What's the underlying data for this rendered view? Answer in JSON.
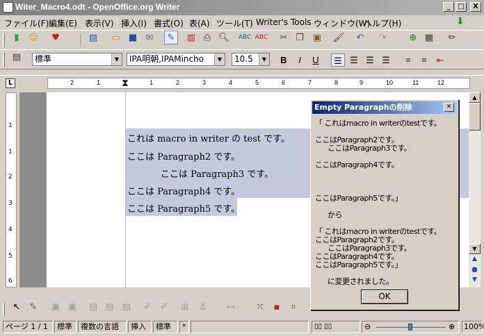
{
  "window": {
    "title": "Witer_Macro4.odt - OpenOffice.org Writer"
  },
  "window_buttons": {
    "minimize": "_",
    "maximize": "□",
    "close": "X"
  },
  "menu": [
    "ファイル(F)",
    "編集(E)",
    "表示(V)",
    "挿入(I)",
    "書式(O)",
    "表(A)",
    "ツール(T)",
    "Writer's Tools",
    "ウィンドウ(W)",
    "ヘルプ(H)"
  ],
  "format_toolbar": {
    "style": "標準",
    "font": "IPA明朝,IPAMincho",
    "size": "10.5",
    "bold": "B",
    "italic": "I",
    "underline": "U"
  },
  "ruler": {
    "marks": [
      "2",
      "1",
      "1",
      "2",
      "3",
      "4",
      "5",
      "6",
      "7",
      "8",
      "9",
      "10",
      "11",
      "12"
    ]
  },
  "vruler": {
    "marks": [
      "1",
      "1",
      "2",
      "3",
      "4",
      "5",
      "6"
    ]
  },
  "document": {
    "lines": [
      "これは macro in writer の test です。",
      "ここは Paragraph2 です。",
      "ここは Paragraph3 です。",
      "ここは Paragraph4 です。",
      "ここは Paragraph5 です。"
    ]
  },
  "dialog": {
    "title": "Empty Paragraphの削除",
    "message": "「 これはmacro in writerのtestです。\n\nここはParagraph2です。\n      ここはParagraph3です。\n\nここはParagraph4です。\n\n\n\nここはParagraph5です。」\n\n      から\n\n「 これはmacro in writerのtestです。\nここはParagraph2です。\n      ここはParagraph3です。\nここはParagraph4です。\nここはParagraph5です。」\n\n      に変更されました。",
    "ok": "OK"
  },
  "statusbar": {
    "page": "ページ 1 / 1",
    "style": "標準",
    "language": "複数の言語",
    "insert": "挿入",
    "mode": "標準",
    "modified": "*",
    "zoom": "100%"
  }
}
